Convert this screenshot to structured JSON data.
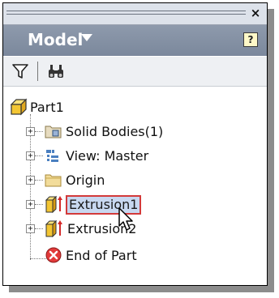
{
  "panel": {
    "close_glyph": "×",
    "title": "Model",
    "help_glyph": "?"
  },
  "toolbar": {
    "filter_icon": "filter-icon",
    "find_icon": "binoculars-icon"
  },
  "tree": {
    "root": "Part1",
    "items": [
      {
        "label": "Solid Bodies(1)",
        "icon": "solid-bodies-icon"
      },
      {
        "label": "View: Master",
        "icon": "view-icon"
      },
      {
        "label": "Origin",
        "icon": "folder-icon"
      },
      {
        "label": "Extrusion1",
        "icon": "extrusion-icon",
        "selected": true
      },
      {
        "label": "Extrusion2",
        "icon": "extrusion-icon"
      },
      {
        "label": "End of Part",
        "icon": "end-of-part-icon"
      }
    ]
  },
  "colors": {
    "header": "#8e9aac",
    "selection_outline": "#d33a3a",
    "part_icon": "#f3c633"
  }
}
